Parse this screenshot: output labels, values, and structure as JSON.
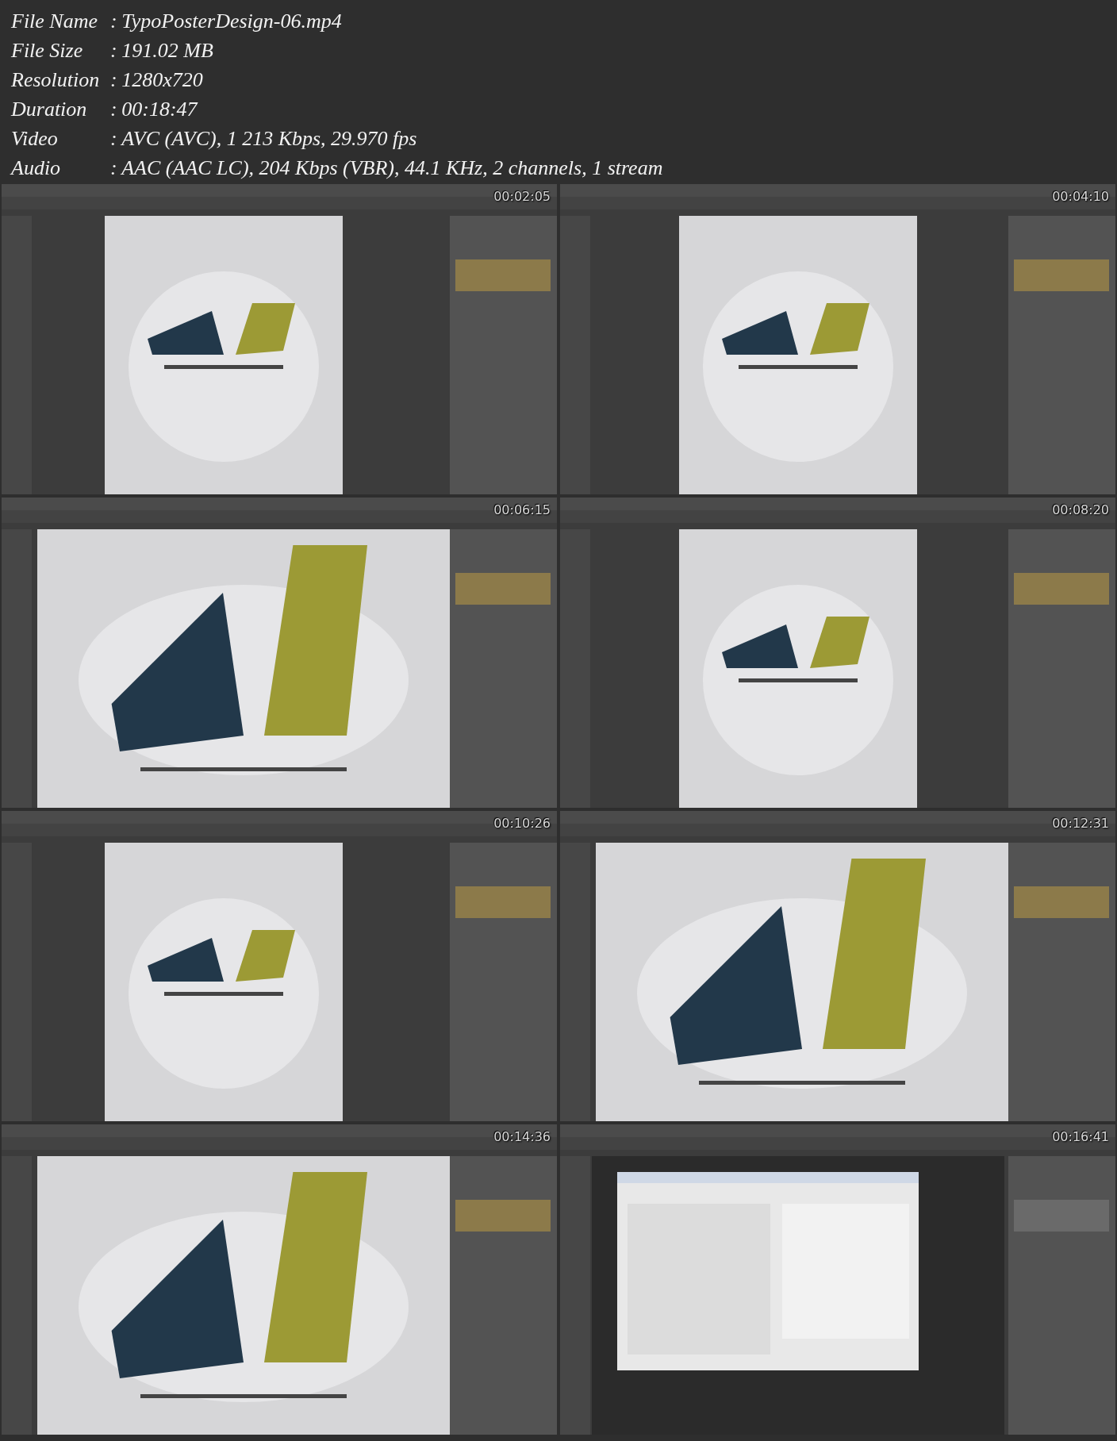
{
  "file_info": [
    {
      "label": "File Name",
      "separator": ":",
      "value": "TypoPosterDesign-06.mp4"
    },
    {
      "label": "File Size",
      "separator": ":",
      "value": "191.02 MB"
    },
    {
      "label": "Resolution",
      "separator": ":",
      "value": "1280x720"
    },
    {
      "label": "Duration",
      "separator": ":",
      "value": "00:18:47"
    },
    {
      "label": "Video",
      "separator": ":",
      "value": "AVC (AVC), 1 213 Kbps, 29.970 fps"
    },
    {
      "label": "Audio",
      "separator": ":",
      "value": "AAC (AAC LC), 204 Kbps (VBR), 44.1 KHz, 2 channels, 1 stream"
    }
  ],
  "thumbnails": [
    {
      "timestamp": "00:02:05"
    },
    {
      "timestamp": "00:04:10"
    },
    {
      "timestamp": "00:06:15"
    },
    {
      "timestamp": "00:08:20"
    },
    {
      "timestamp": "00:10:26"
    },
    {
      "timestamp": "00:12:31"
    },
    {
      "timestamp": "00:14:36"
    },
    {
      "timestamp": "00:16:41"
    }
  ]
}
